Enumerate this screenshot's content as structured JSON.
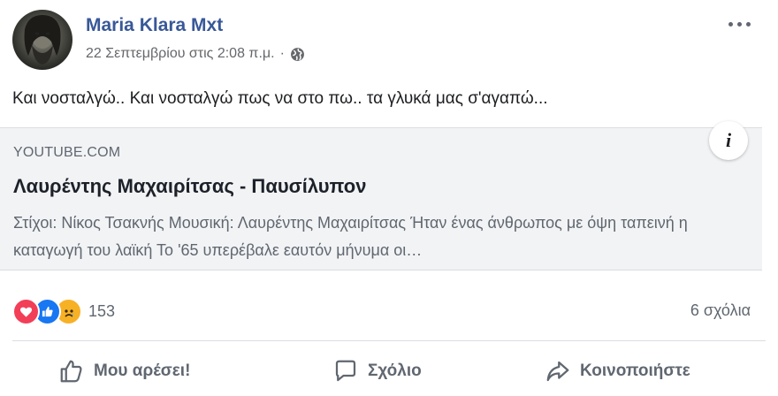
{
  "post": {
    "author": "Maria Klara Mxt",
    "timestamp": "22 Σεπτεμβρίου στις 2:08 π.μ.",
    "separator": "·",
    "audience_icon": "globe-icon",
    "text": "Και νοσταλγώ.. Και νοσταλγώ πως να στο πω.. τα γλυκά μας σ'αγαπώ..."
  },
  "link_card": {
    "domain": "YOUTUBE.COM",
    "title": "Λαυρέντης Μαχαιρίτσας - Παυσίλυπον",
    "description": "Στίχοι: Νίκος Τσακνής Μουσική: Λαυρέντης Μαχαιρίτσας Ήταν ένας άνθρωπος με όψη ταπεινή η καταγωγή του λαϊκή Το '65 υπερέβαλε εαυτόν μήνυμα οι…",
    "info_label": "i"
  },
  "reactions": {
    "types": [
      "love-icon",
      "like-icon",
      "sad-icon"
    ],
    "count": "153",
    "comments": "6 σχόλια"
  },
  "actions": {
    "like": "Μου αρέσει!",
    "comment": "Σχόλιο",
    "share": "Κοινοποιήστε"
  },
  "colors": {
    "author": "#385898",
    "love": "#f33e58",
    "like": "#1877f2",
    "sad": "#f7b125",
    "card_bg": "#f2f3f5"
  }
}
